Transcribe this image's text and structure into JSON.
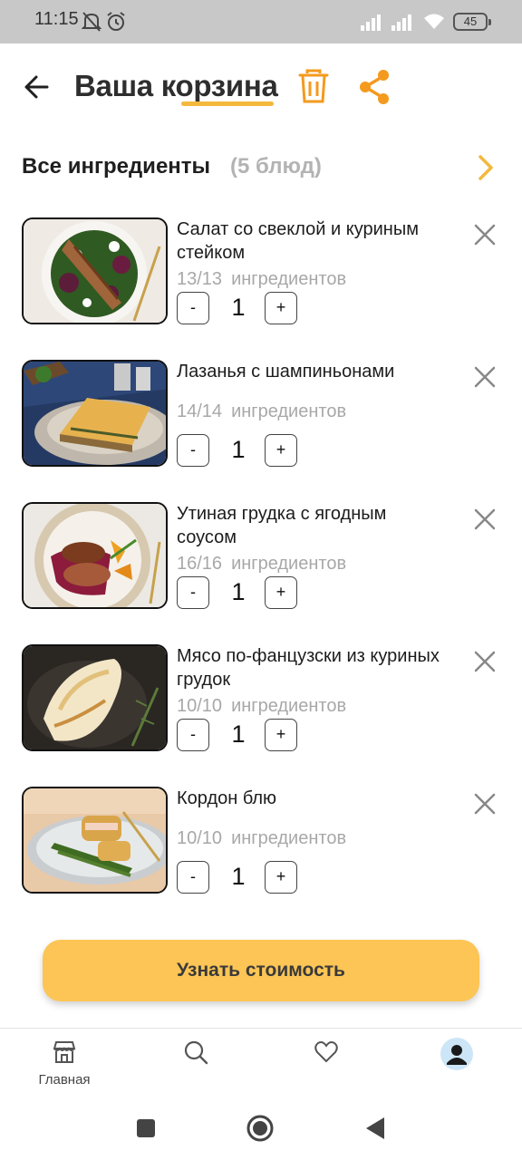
{
  "status_bar": {
    "time": "11:15",
    "battery": "45"
  },
  "header": {
    "title": "Ваша корзина",
    "accent_color": "#f49a1e",
    "underline_color": "#f4b83d"
  },
  "all_ingredients": {
    "label": "Все ингредиенты",
    "count": "(5 блюд)"
  },
  "dishes": [
    {
      "name": "Салат со свеклой и куриным стейком",
      "ingredients_count": "13/13",
      "ingredients_label": "ингредиентов",
      "quantity": "1"
    },
    {
      "name": "Лазанья с шампиньонами",
      "ingredients_count": "14/14",
      "ingredients_label": "ингредиентов",
      "quantity": "1"
    },
    {
      "name": "Утиная грудка с ягодным соусом",
      "ingredients_count": "16/16",
      "ingredients_label": "ингредиентов",
      "quantity": "1"
    },
    {
      "name": "Мясо по-фанцузски из куриных грудок",
      "ingredients_count": "10/10",
      "ingredients_label": "ингредиентов",
      "quantity": "1"
    },
    {
      "name": "Кордон блю",
      "ingredients_count": "10/10",
      "ingredients_label": "ингредиентов",
      "quantity": "1"
    }
  ],
  "qty_controls": {
    "minus": "-",
    "plus": "+"
  },
  "cta": {
    "label": "Узнать стоимость",
    "color": "#fcc555"
  },
  "bottom_nav": {
    "items": [
      {
        "label": "Главная",
        "icon": "store-icon"
      },
      {
        "label": "",
        "icon": "search-icon"
      },
      {
        "label": "",
        "icon": "heart-icon"
      },
      {
        "label": "",
        "icon": "profile-avatar-icon"
      }
    ]
  }
}
